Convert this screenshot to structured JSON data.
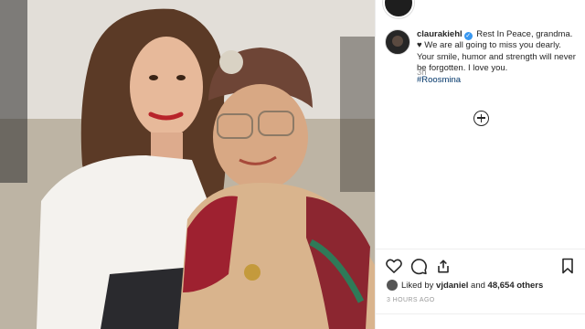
{
  "post": {
    "username": "claurakiehl",
    "caption": "Rest In Peace, grandma. ♥ We are all going to miss you dearly. Your smile, humor and strength will never be forgotten. I love you.",
    "hashtag": "#Roosmina",
    "time_ago": "3h"
  },
  "actions": {
    "like_icon": "heart-icon",
    "comment_icon": "comment-icon",
    "share_icon": "share-icon",
    "save_icon": "bookmark-icon"
  },
  "likes": {
    "prefix": "Liked by",
    "user": "vjdaniel",
    "conjunction": "and",
    "count": "48,654 others"
  },
  "timestamp": "3 HOURS AGO",
  "colors": {
    "link": "#003569",
    "verified": "#3897f0",
    "muted": "#999999"
  }
}
